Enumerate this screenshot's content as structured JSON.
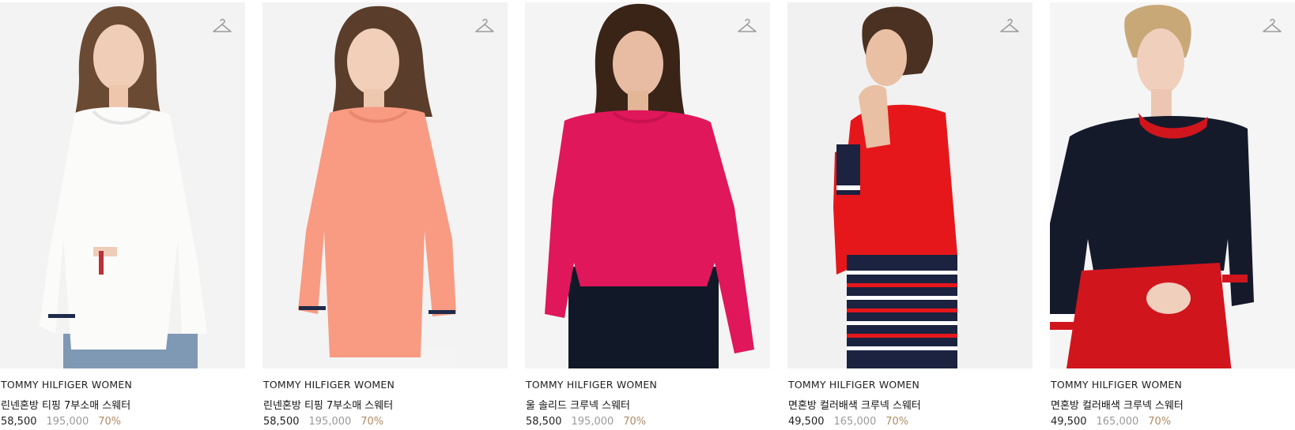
{
  "products": [
    {
      "brand": "TOMMY HILFIGER WOMEN",
      "name": "린넨혼방 티핑 7부소매 스웨터",
      "price": "58,500",
      "original_price": "195,000",
      "discount": "70%",
      "icon": "hanger-icon",
      "colors": {
        "garment": "#fbfbfa",
        "bottom": "#7f98b4",
        "hair": "#6b4a34"
      }
    },
    {
      "brand": "TOMMY HILFIGER WOMEN",
      "name": "린넨혼방 티핑 7부소매 스웨터",
      "price": "58,500",
      "original_price": "195,000",
      "discount": "70%",
      "icon": "hanger-icon",
      "colors": {
        "garment": "#f89b82",
        "bottom": "#f4f4f4",
        "hair": "#5a3d2a"
      }
    },
    {
      "brand": "TOMMY HILFIGER WOMEN",
      "name": "울 솔리드 크루넥 스웨터",
      "price": "58,500",
      "original_price": "195,000",
      "discount": "70%",
      "icon": "hanger-icon",
      "colors": {
        "garment": "#e0175a",
        "bottom": "#111827",
        "hair": "#3a2418"
      }
    },
    {
      "brand": "TOMMY HILFIGER WOMEN",
      "name": "면혼방 컬러배색 크루넥 스웨터",
      "price": "49,500",
      "original_price": "165,000",
      "discount": "70%",
      "icon": "hanger-icon",
      "colors": {
        "garment": "#e6171b",
        "bottom": "#1b2340",
        "hair": "#4a3122"
      }
    },
    {
      "brand": "TOMMY HILFIGER WOMEN",
      "name": "면혼방 컬러배색 크루넥 스웨터",
      "price": "49,500",
      "original_price": "165,000",
      "discount": "70%",
      "icon": "hanger-icon",
      "colors": {
        "garment": "#151a2b",
        "bottom": "#d1151d",
        "hair": "#c9a878"
      }
    }
  ]
}
